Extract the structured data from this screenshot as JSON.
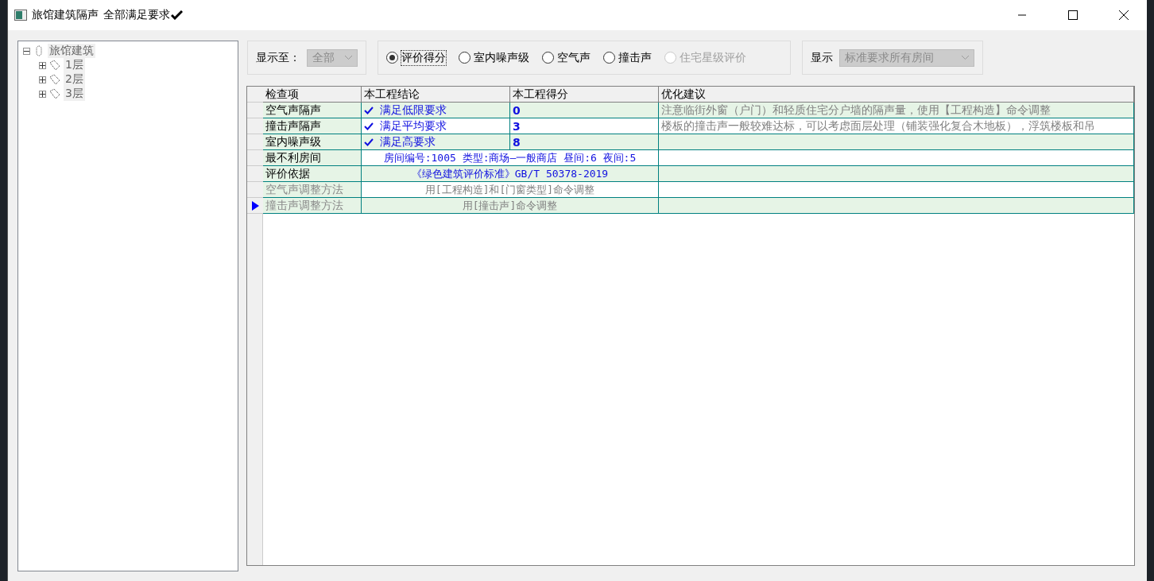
{
  "window": {
    "title": "旅馆建筑隔声",
    "status": "全部满足要求"
  },
  "tree": {
    "label": "旅馆建筑",
    "expanded": true,
    "children": [
      {
        "label": "1层",
        "expanded": false
      },
      {
        "label": "2层",
        "expanded": false
      },
      {
        "label": "3层",
        "expanded": false
      }
    ]
  },
  "show_to": {
    "label": "显示至：",
    "value": "全部",
    "disabled": true
  },
  "radios": [
    {
      "label": "评价得分",
      "selected": true,
      "disabled": false
    },
    {
      "label": "室内噪声级",
      "selected": false,
      "disabled": false
    },
    {
      "label": "空气声",
      "selected": false,
      "disabled": false
    },
    {
      "label": "撞击声",
      "selected": false,
      "disabled": false
    },
    {
      "label": "住宅星级评价",
      "selected": false,
      "disabled": true
    }
  ],
  "display": {
    "label": "显示",
    "value": "标准要求所有房间",
    "disabled": true
  },
  "table": {
    "columns": [
      "检查项",
      "本工程结论",
      "本工程得分",
      "优化建议"
    ],
    "rows": [
      {
        "kind": "result",
        "item": "空气声隔声",
        "conclusion": "满足低限要求",
        "met": true,
        "score": "0",
        "suggestion": "注意临街外窗（户门）和轻质住宅分户墙的隔声量，使用【工程构造】命令调整",
        "disabled": false,
        "selected": false
      },
      {
        "kind": "result",
        "item": "撞击声隔声",
        "conclusion": "满足平均要求",
        "met": true,
        "score": "3",
        "suggestion": "楼板的撞击声一般较难达标，可以考虑面层处理（铺装强化复合木地板），浮筑楼板和吊",
        "disabled": false,
        "selected": false
      },
      {
        "kind": "result",
        "item": "室内噪声级",
        "conclusion": "满足高要求",
        "met": true,
        "score": "8",
        "disabled": false,
        "selected": false
      },
      {
        "kind": "merged",
        "item": "最不利房间",
        "value": "房间编号:1005 类型:商场—一般商店 昼间:6 夜间:5",
        "disabled": false,
        "selected": false
      },
      {
        "kind": "merged",
        "item": "评价依据",
        "value": "《绿色建筑评价标准》GB/T 50378-2019",
        "disabled": false,
        "selected": false
      },
      {
        "kind": "merged",
        "item": "空气声调整方法",
        "value": "用[工程构造]和[门窗类型]命令调整",
        "disabled": true,
        "selected": false
      },
      {
        "kind": "merged",
        "item": "撞击声调整方法",
        "value": "用[撞击声]命令调整",
        "disabled": true,
        "selected": true
      }
    ]
  }
}
